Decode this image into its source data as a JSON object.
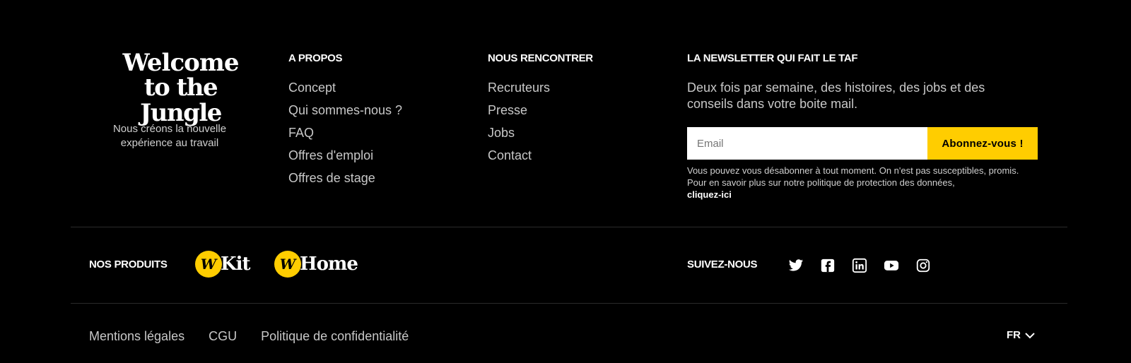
{
  "brand": {
    "logo_line1": "Welcome",
    "logo_line2": "to the Jungle",
    "tagline": "Nous créons la nouvelle expérience au travail"
  },
  "apropos": {
    "heading": "A PROPOS",
    "links": [
      "Concept",
      "Qui sommes-nous ?",
      "FAQ",
      "Offres d'emploi",
      "Offres de stage"
    ]
  },
  "rencontrer": {
    "heading": "NOUS RENCONTRER",
    "links": [
      "Recruteurs",
      "Presse",
      "Jobs",
      "Contact"
    ]
  },
  "newsletter": {
    "heading": "LA NEWSLETTER QUI FAIT LE TAF",
    "description": "Deux fois par semaine, des histoires, des jobs et des conseils dans votre boite mail.",
    "email_placeholder": "Email",
    "email_value": "",
    "button_label": "Abonnez-vous !",
    "note": "Vous pouvez vous désabonner à tout moment. On n'est pas susceptibles, promis. Pour en savoir plus sur notre politique de protection des données,",
    "note_link": "cliquez-ici"
  },
  "products": {
    "label": "NOS PRODUITS",
    "items": [
      {
        "badge": "W",
        "name": "Kit"
      },
      {
        "badge": "W",
        "name": "Home"
      }
    ]
  },
  "social": {
    "label": "SUIVEZ-NOUS",
    "icons": [
      "twitter-icon",
      "facebook-icon",
      "linkedin-icon",
      "youtube-icon",
      "instagram-icon"
    ]
  },
  "legal": {
    "links": [
      "Mentions légales",
      "CGU",
      "Politique de confidentialité"
    ]
  },
  "language": {
    "current": "FR"
  },
  "colors": {
    "background": "#000000",
    "accent": "#ffcd00",
    "muted_text": "#c8c8c8"
  }
}
